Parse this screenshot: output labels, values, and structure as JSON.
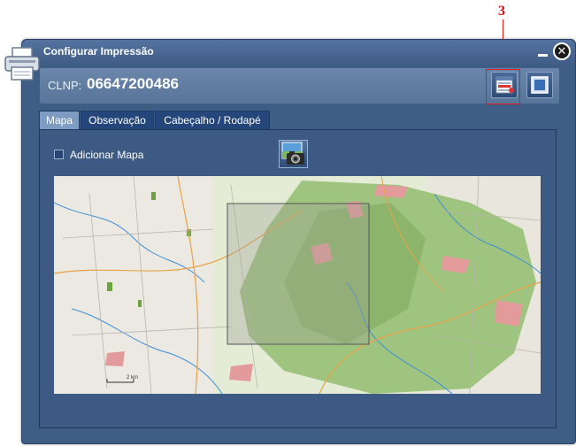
{
  "callout": {
    "number": "3"
  },
  "dialog": {
    "title": "Configurar Impressão",
    "clnp_label": "CLNP:",
    "clnp_value": "06647200486",
    "close_icon": "close-icon",
    "minimize_icon": "minimize-icon"
  },
  "tabs": [
    {
      "label": "Mapa",
      "active": true
    },
    {
      "label": "Observação",
      "active": false
    },
    {
      "label": "Cabeçalho / Rodapé",
      "active": false
    }
  ],
  "panel": {
    "add_map_label": "Adicionar Mapa",
    "add_map_checked": false,
    "camera_icon": "camera-icon"
  },
  "map": {
    "scale_label": "2 km"
  },
  "colors": {
    "dialog_bg": "#3f5e86",
    "highlight": "#e01818",
    "map_park": "#9fc47f"
  }
}
